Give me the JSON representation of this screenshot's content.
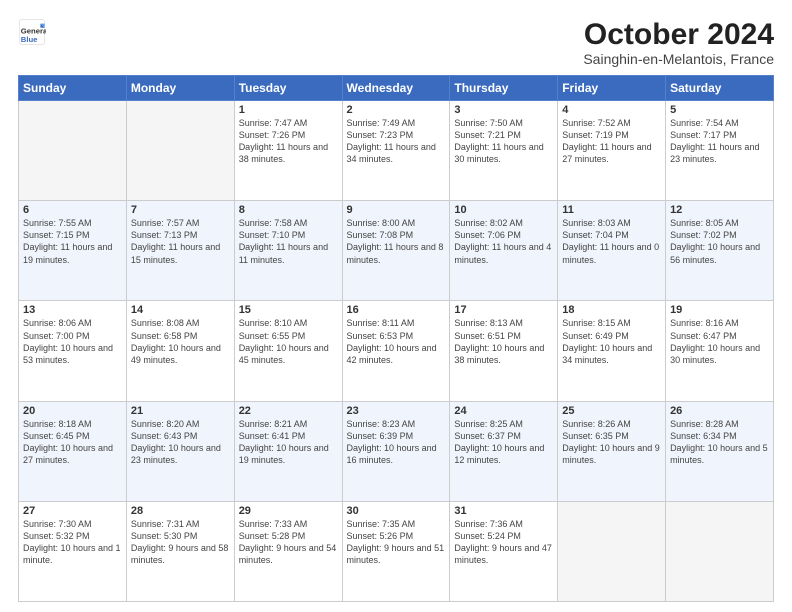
{
  "logo": {
    "general": "General",
    "blue": "Blue"
  },
  "title": "October 2024",
  "subtitle": "Sainghin-en-Melantois, France",
  "days_of_week": [
    "Sunday",
    "Monday",
    "Tuesday",
    "Wednesday",
    "Thursday",
    "Friday",
    "Saturday"
  ],
  "weeks": [
    [
      {
        "num": "",
        "info": ""
      },
      {
        "num": "",
        "info": ""
      },
      {
        "num": "1",
        "info": "Sunrise: 7:47 AM\nSunset: 7:26 PM\nDaylight: 11 hours and 38 minutes."
      },
      {
        "num": "2",
        "info": "Sunrise: 7:49 AM\nSunset: 7:23 PM\nDaylight: 11 hours and 34 minutes."
      },
      {
        "num": "3",
        "info": "Sunrise: 7:50 AM\nSunset: 7:21 PM\nDaylight: 11 hours and 30 minutes."
      },
      {
        "num": "4",
        "info": "Sunrise: 7:52 AM\nSunset: 7:19 PM\nDaylight: 11 hours and 27 minutes."
      },
      {
        "num": "5",
        "info": "Sunrise: 7:54 AM\nSunset: 7:17 PM\nDaylight: 11 hours and 23 minutes."
      }
    ],
    [
      {
        "num": "6",
        "info": "Sunrise: 7:55 AM\nSunset: 7:15 PM\nDaylight: 11 hours and 19 minutes."
      },
      {
        "num": "7",
        "info": "Sunrise: 7:57 AM\nSunset: 7:13 PM\nDaylight: 11 hours and 15 minutes."
      },
      {
        "num": "8",
        "info": "Sunrise: 7:58 AM\nSunset: 7:10 PM\nDaylight: 11 hours and 11 minutes."
      },
      {
        "num": "9",
        "info": "Sunrise: 8:00 AM\nSunset: 7:08 PM\nDaylight: 11 hours and 8 minutes."
      },
      {
        "num": "10",
        "info": "Sunrise: 8:02 AM\nSunset: 7:06 PM\nDaylight: 11 hours and 4 minutes."
      },
      {
        "num": "11",
        "info": "Sunrise: 8:03 AM\nSunset: 7:04 PM\nDaylight: 11 hours and 0 minutes."
      },
      {
        "num": "12",
        "info": "Sunrise: 8:05 AM\nSunset: 7:02 PM\nDaylight: 10 hours and 56 minutes."
      }
    ],
    [
      {
        "num": "13",
        "info": "Sunrise: 8:06 AM\nSunset: 7:00 PM\nDaylight: 10 hours and 53 minutes."
      },
      {
        "num": "14",
        "info": "Sunrise: 8:08 AM\nSunset: 6:58 PM\nDaylight: 10 hours and 49 minutes."
      },
      {
        "num": "15",
        "info": "Sunrise: 8:10 AM\nSunset: 6:55 PM\nDaylight: 10 hours and 45 minutes."
      },
      {
        "num": "16",
        "info": "Sunrise: 8:11 AM\nSunset: 6:53 PM\nDaylight: 10 hours and 42 minutes."
      },
      {
        "num": "17",
        "info": "Sunrise: 8:13 AM\nSunset: 6:51 PM\nDaylight: 10 hours and 38 minutes."
      },
      {
        "num": "18",
        "info": "Sunrise: 8:15 AM\nSunset: 6:49 PM\nDaylight: 10 hours and 34 minutes."
      },
      {
        "num": "19",
        "info": "Sunrise: 8:16 AM\nSunset: 6:47 PM\nDaylight: 10 hours and 30 minutes."
      }
    ],
    [
      {
        "num": "20",
        "info": "Sunrise: 8:18 AM\nSunset: 6:45 PM\nDaylight: 10 hours and 27 minutes."
      },
      {
        "num": "21",
        "info": "Sunrise: 8:20 AM\nSunset: 6:43 PM\nDaylight: 10 hours and 23 minutes."
      },
      {
        "num": "22",
        "info": "Sunrise: 8:21 AM\nSunset: 6:41 PM\nDaylight: 10 hours and 19 minutes."
      },
      {
        "num": "23",
        "info": "Sunrise: 8:23 AM\nSunset: 6:39 PM\nDaylight: 10 hours and 16 minutes."
      },
      {
        "num": "24",
        "info": "Sunrise: 8:25 AM\nSunset: 6:37 PM\nDaylight: 10 hours and 12 minutes."
      },
      {
        "num": "25",
        "info": "Sunrise: 8:26 AM\nSunset: 6:35 PM\nDaylight: 10 hours and 9 minutes."
      },
      {
        "num": "26",
        "info": "Sunrise: 8:28 AM\nSunset: 6:34 PM\nDaylight: 10 hours and 5 minutes."
      }
    ],
    [
      {
        "num": "27",
        "info": "Sunrise: 7:30 AM\nSunset: 5:32 PM\nDaylight: 10 hours and 1 minute."
      },
      {
        "num": "28",
        "info": "Sunrise: 7:31 AM\nSunset: 5:30 PM\nDaylight: 9 hours and 58 minutes."
      },
      {
        "num": "29",
        "info": "Sunrise: 7:33 AM\nSunset: 5:28 PM\nDaylight: 9 hours and 54 minutes."
      },
      {
        "num": "30",
        "info": "Sunrise: 7:35 AM\nSunset: 5:26 PM\nDaylight: 9 hours and 51 minutes."
      },
      {
        "num": "31",
        "info": "Sunrise: 7:36 AM\nSunset: 5:24 PM\nDaylight: 9 hours and 47 minutes."
      },
      {
        "num": "",
        "info": ""
      },
      {
        "num": "",
        "info": ""
      }
    ]
  ]
}
